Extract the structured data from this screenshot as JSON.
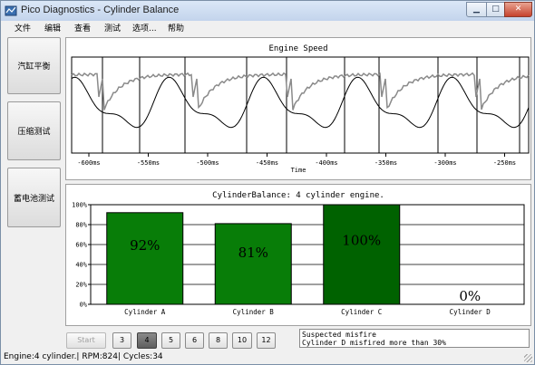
{
  "window": {
    "title": "Pico Diagnostics - Cylinder Balance"
  },
  "menu": [
    "文件",
    "编辑",
    "查看",
    "测试",
    "选项...",
    "帮助"
  ],
  "sidebar": {
    "buttons": [
      "汽缸平衡",
      "压缩测试",
      "蓄电池测试"
    ]
  },
  "engine_speed_chart": {
    "title": "Engine Speed",
    "xlabel": "Time",
    "tick_labels": [
      "-600ms",
      "-550ms",
      "-500ms",
      "-450ms",
      "-400ms",
      "-350ms",
      "-300ms",
      "-250ms"
    ]
  },
  "chart_data": {
    "type": "bar",
    "title": "CylinderBalance: 4 cylinder engine.",
    "categories": [
      "Cylinder A",
      "Cylinder B",
      "Cylinder C",
      "Cylinder D"
    ],
    "values": [
      92,
      81,
      100,
      0
    ],
    "value_labels": [
      "92%",
      "81%",
      "100%",
      "0%"
    ],
    "y_tick_labels": [
      "100%",
      "80%",
      "60%",
      "40%",
      "20%",
      "0%"
    ],
    "ylim": [
      0,
      100
    ],
    "grid": true,
    "colors": [
      "#087d08",
      "#087d08",
      "#006200",
      "#087d08"
    ]
  },
  "controls": {
    "start_label": "Start",
    "cycle_options": [
      "3",
      "4",
      "5",
      "6",
      "8",
      "10",
      "12"
    ],
    "selected_cycle": "4"
  },
  "messages": {
    "line1": "Suspected misfire",
    "line2": "Cylinder D misfired more than 30%"
  },
  "status": {
    "text": "Engine:4 cylinder.| RPM:824| Cycles:34"
  }
}
